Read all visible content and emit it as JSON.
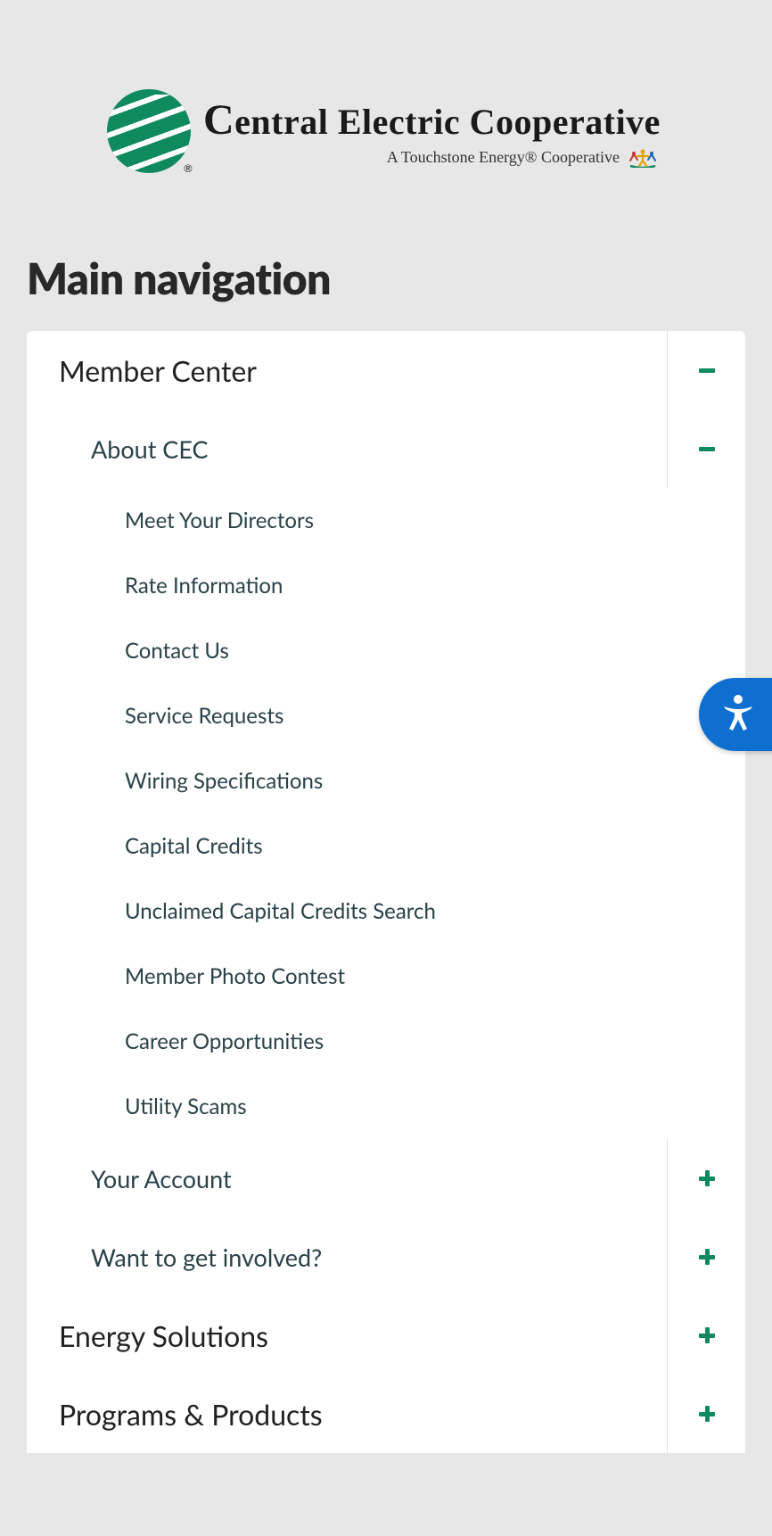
{
  "logo": {
    "name_html": "Central Electric Cooperative",
    "tagline": "A Touchstone Energy® Cooperative"
  },
  "heading": "Main navigation",
  "nav": {
    "member_center": {
      "label": "Member Center",
      "expanded": true
    },
    "about_cec": {
      "label": "About CEC",
      "expanded": true,
      "items": [
        "Meet Your Directors",
        "Rate Information",
        "Contact Us",
        "Service Requests",
        "Wiring Specifications",
        "Capital Credits",
        "Unclaimed Capital Credits Search",
        "Member Photo Contest",
        "Career Opportunities",
        "Utility Scams"
      ]
    },
    "your_account": {
      "label": "Your Account",
      "expanded": false
    },
    "get_involved": {
      "label": "Want to get involved?",
      "expanded": false
    },
    "energy_solutions": {
      "label": "Energy Solutions",
      "expanded": false
    },
    "programs_products": {
      "label": "Programs & Products",
      "expanded": false
    }
  },
  "colors": {
    "accent_green": "#0f8a5f",
    "accessibility_blue": "#0f6fd0"
  }
}
